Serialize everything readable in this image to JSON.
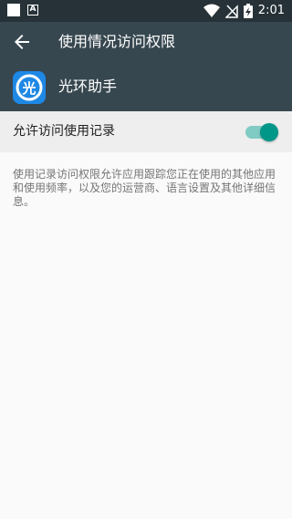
{
  "status_bar": {
    "time": "2:01"
  },
  "toolbar": {
    "title": "使用情况访问权限"
  },
  "app": {
    "name": "光环助手",
    "icon_glyph": "光"
  },
  "setting": {
    "label": "允许访问使用记录",
    "enabled": true
  },
  "description": "使用记录访问权限允许应用跟踪您正在使用的其他应用和使用频率，以及您的运营商、语言设置及其他详细信息。",
  "colors": {
    "toolbar": "#37474f",
    "status_bar": "#263238",
    "accent": "#009688",
    "app_icon_bg": "#1e88e5"
  }
}
